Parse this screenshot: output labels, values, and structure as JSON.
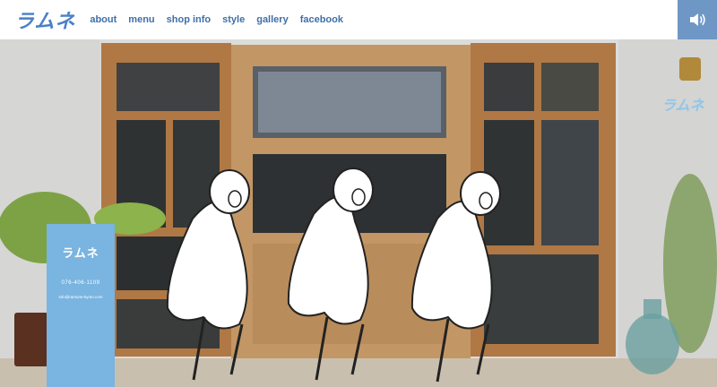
{
  "header": {
    "logo": "ラムネ",
    "nav": [
      {
        "label": "about"
      },
      {
        "label": "menu"
      },
      {
        "label": "shop info"
      },
      {
        "label": "style"
      },
      {
        "label": "gallery"
      },
      {
        "label": "facebook"
      }
    ],
    "sound_icon": "speaker-icon"
  },
  "hero": {
    "sign": {
      "title": "ラムネ",
      "phone": "076-406-1109",
      "email": "info@ramune-kyoto.com"
    },
    "wall_logo": "ラムネ"
  },
  "colors": {
    "accent": "#6f97c6",
    "logo": "#4a80c7",
    "nav": "#3f6fa8",
    "sign": "#7ab4e0",
    "wood": "#b17a45"
  }
}
